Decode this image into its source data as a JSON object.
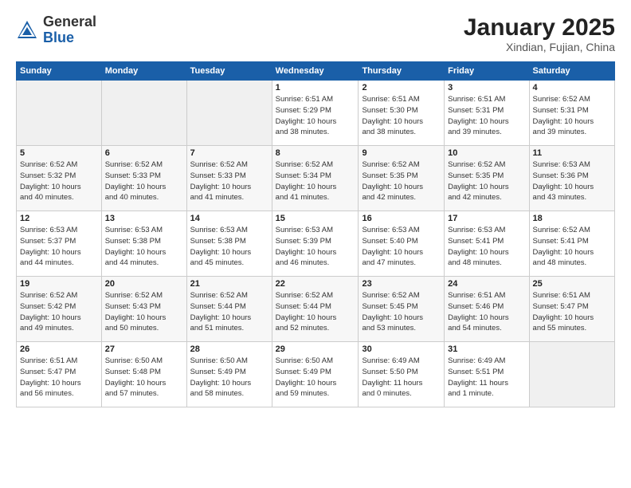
{
  "header": {
    "logo_general": "General",
    "logo_blue": "Blue",
    "month_title": "January 2025",
    "subtitle": "Xindian, Fujian, China"
  },
  "weekdays": [
    "Sunday",
    "Monday",
    "Tuesday",
    "Wednesday",
    "Thursday",
    "Friday",
    "Saturday"
  ],
  "weeks": [
    [
      {
        "day": "",
        "info": ""
      },
      {
        "day": "",
        "info": ""
      },
      {
        "day": "",
        "info": ""
      },
      {
        "day": "1",
        "info": "Sunrise: 6:51 AM\nSunset: 5:29 PM\nDaylight: 10 hours\nand 38 minutes."
      },
      {
        "day": "2",
        "info": "Sunrise: 6:51 AM\nSunset: 5:30 PM\nDaylight: 10 hours\nand 38 minutes."
      },
      {
        "day": "3",
        "info": "Sunrise: 6:51 AM\nSunset: 5:31 PM\nDaylight: 10 hours\nand 39 minutes."
      },
      {
        "day": "4",
        "info": "Sunrise: 6:52 AM\nSunset: 5:31 PM\nDaylight: 10 hours\nand 39 minutes."
      }
    ],
    [
      {
        "day": "5",
        "info": "Sunrise: 6:52 AM\nSunset: 5:32 PM\nDaylight: 10 hours\nand 40 minutes."
      },
      {
        "day": "6",
        "info": "Sunrise: 6:52 AM\nSunset: 5:33 PM\nDaylight: 10 hours\nand 40 minutes."
      },
      {
        "day": "7",
        "info": "Sunrise: 6:52 AM\nSunset: 5:33 PM\nDaylight: 10 hours\nand 41 minutes."
      },
      {
        "day": "8",
        "info": "Sunrise: 6:52 AM\nSunset: 5:34 PM\nDaylight: 10 hours\nand 41 minutes."
      },
      {
        "day": "9",
        "info": "Sunrise: 6:52 AM\nSunset: 5:35 PM\nDaylight: 10 hours\nand 42 minutes."
      },
      {
        "day": "10",
        "info": "Sunrise: 6:52 AM\nSunset: 5:35 PM\nDaylight: 10 hours\nand 42 minutes."
      },
      {
        "day": "11",
        "info": "Sunrise: 6:53 AM\nSunset: 5:36 PM\nDaylight: 10 hours\nand 43 minutes."
      }
    ],
    [
      {
        "day": "12",
        "info": "Sunrise: 6:53 AM\nSunset: 5:37 PM\nDaylight: 10 hours\nand 44 minutes."
      },
      {
        "day": "13",
        "info": "Sunrise: 6:53 AM\nSunset: 5:38 PM\nDaylight: 10 hours\nand 44 minutes."
      },
      {
        "day": "14",
        "info": "Sunrise: 6:53 AM\nSunset: 5:38 PM\nDaylight: 10 hours\nand 45 minutes."
      },
      {
        "day": "15",
        "info": "Sunrise: 6:53 AM\nSunset: 5:39 PM\nDaylight: 10 hours\nand 46 minutes."
      },
      {
        "day": "16",
        "info": "Sunrise: 6:53 AM\nSunset: 5:40 PM\nDaylight: 10 hours\nand 47 minutes."
      },
      {
        "day": "17",
        "info": "Sunrise: 6:53 AM\nSunset: 5:41 PM\nDaylight: 10 hours\nand 48 minutes."
      },
      {
        "day": "18",
        "info": "Sunrise: 6:52 AM\nSunset: 5:41 PM\nDaylight: 10 hours\nand 48 minutes."
      }
    ],
    [
      {
        "day": "19",
        "info": "Sunrise: 6:52 AM\nSunset: 5:42 PM\nDaylight: 10 hours\nand 49 minutes."
      },
      {
        "day": "20",
        "info": "Sunrise: 6:52 AM\nSunset: 5:43 PM\nDaylight: 10 hours\nand 50 minutes."
      },
      {
        "day": "21",
        "info": "Sunrise: 6:52 AM\nSunset: 5:44 PM\nDaylight: 10 hours\nand 51 minutes."
      },
      {
        "day": "22",
        "info": "Sunrise: 6:52 AM\nSunset: 5:44 PM\nDaylight: 10 hours\nand 52 minutes."
      },
      {
        "day": "23",
        "info": "Sunrise: 6:52 AM\nSunset: 5:45 PM\nDaylight: 10 hours\nand 53 minutes."
      },
      {
        "day": "24",
        "info": "Sunrise: 6:51 AM\nSunset: 5:46 PM\nDaylight: 10 hours\nand 54 minutes."
      },
      {
        "day": "25",
        "info": "Sunrise: 6:51 AM\nSunset: 5:47 PM\nDaylight: 10 hours\nand 55 minutes."
      }
    ],
    [
      {
        "day": "26",
        "info": "Sunrise: 6:51 AM\nSunset: 5:47 PM\nDaylight: 10 hours\nand 56 minutes."
      },
      {
        "day": "27",
        "info": "Sunrise: 6:50 AM\nSunset: 5:48 PM\nDaylight: 10 hours\nand 57 minutes."
      },
      {
        "day": "28",
        "info": "Sunrise: 6:50 AM\nSunset: 5:49 PM\nDaylight: 10 hours\nand 58 minutes."
      },
      {
        "day": "29",
        "info": "Sunrise: 6:50 AM\nSunset: 5:49 PM\nDaylight: 10 hours\nand 59 minutes."
      },
      {
        "day": "30",
        "info": "Sunrise: 6:49 AM\nSunset: 5:50 PM\nDaylight: 11 hours\nand 0 minutes."
      },
      {
        "day": "31",
        "info": "Sunrise: 6:49 AM\nSunset: 5:51 PM\nDaylight: 11 hours\nand 1 minute."
      },
      {
        "day": "",
        "info": ""
      }
    ]
  ]
}
